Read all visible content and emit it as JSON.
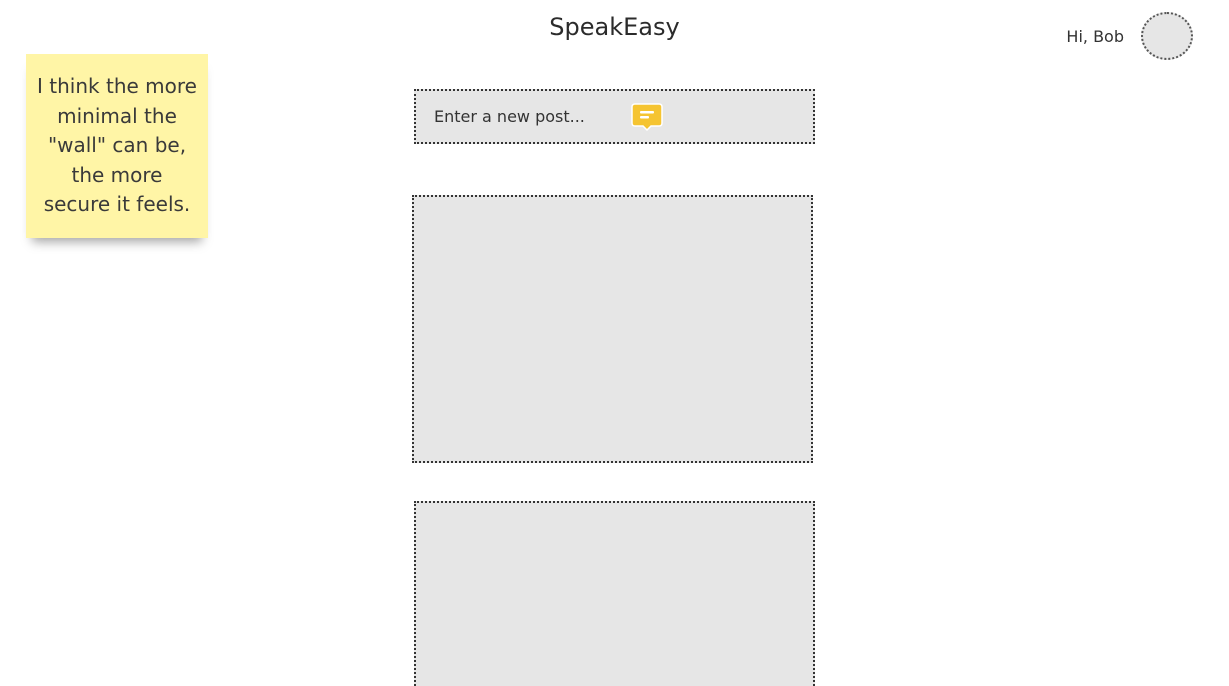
{
  "header": {
    "app_title": "SpeakEasy",
    "greeting": "Hi, Bob"
  },
  "sticky_note": {
    "text": "I think the more minimal the \"wall\" can be, the more secure it feels."
  },
  "composer": {
    "placeholder": "Enter a new post...",
    "post_icon": "chat-bubble-icon",
    "accent_color": "#f5c431"
  },
  "posts": [
    {},
    {}
  ]
}
